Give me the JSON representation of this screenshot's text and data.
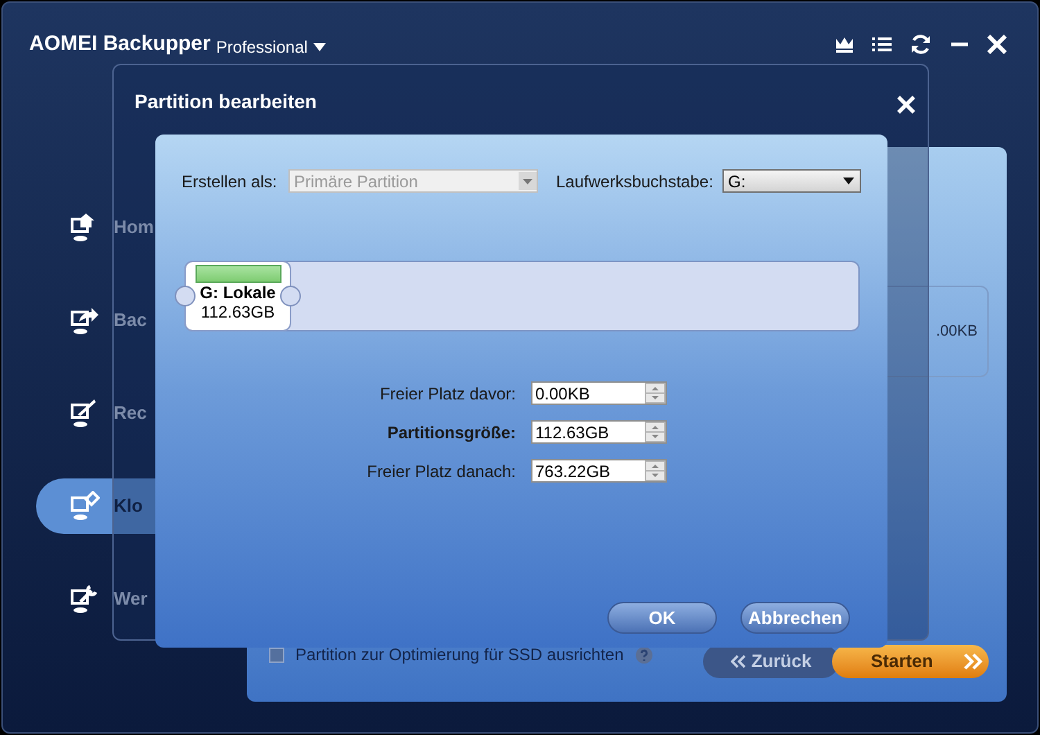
{
  "app": {
    "title": "AOMEI Backupper",
    "edition": "Professional"
  },
  "sidebar": {
    "items": [
      {
        "label": "Hom",
        "selected": false
      },
      {
        "label": "Bac",
        "selected": false
      },
      {
        "label": "Rec",
        "selected": false
      },
      {
        "label": "Klo",
        "selected": true
      },
      {
        "label": "Wer",
        "selected": false
      }
    ]
  },
  "background": {
    "panel_value": ".00KB",
    "ssd_option": {
      "label": "Partition zur Optimierung für SSD ausrichten",
      "checked": false
    },
    "back_button": "Zurück",
    "start_button": "Starten"
  },
  "dialog": {
    "title": "Partition bearbeiten",
    "create_as": {
      "label": "Erstellen als:",
      "value": "Primäre Partition",
      "disabled": true
    },
    "drive_letter": {
      "label": "Laufwerksbuchstabe:",
      "value": "G:",
      "disabled": false
    },
    "partition": {
      "name": "G: Lokale",
      "size": "112.63GB"
    },
    "fields": [
      {
        "label": "Freier Platz davor:",
        "value": "0.00KB",
        "emphasized": false
      },
      {
        "label": "Partitionsgröße:",
        "value": "112.63GB",
        "emphasized": true
      },
      {
        "label": "Freier Platz danach:",
        "value": "763.22GB",
        "emphasized": false
      }
    ],
    "buttons": [
      "OK",
      "Abbrechen"
    ]
  }
}
